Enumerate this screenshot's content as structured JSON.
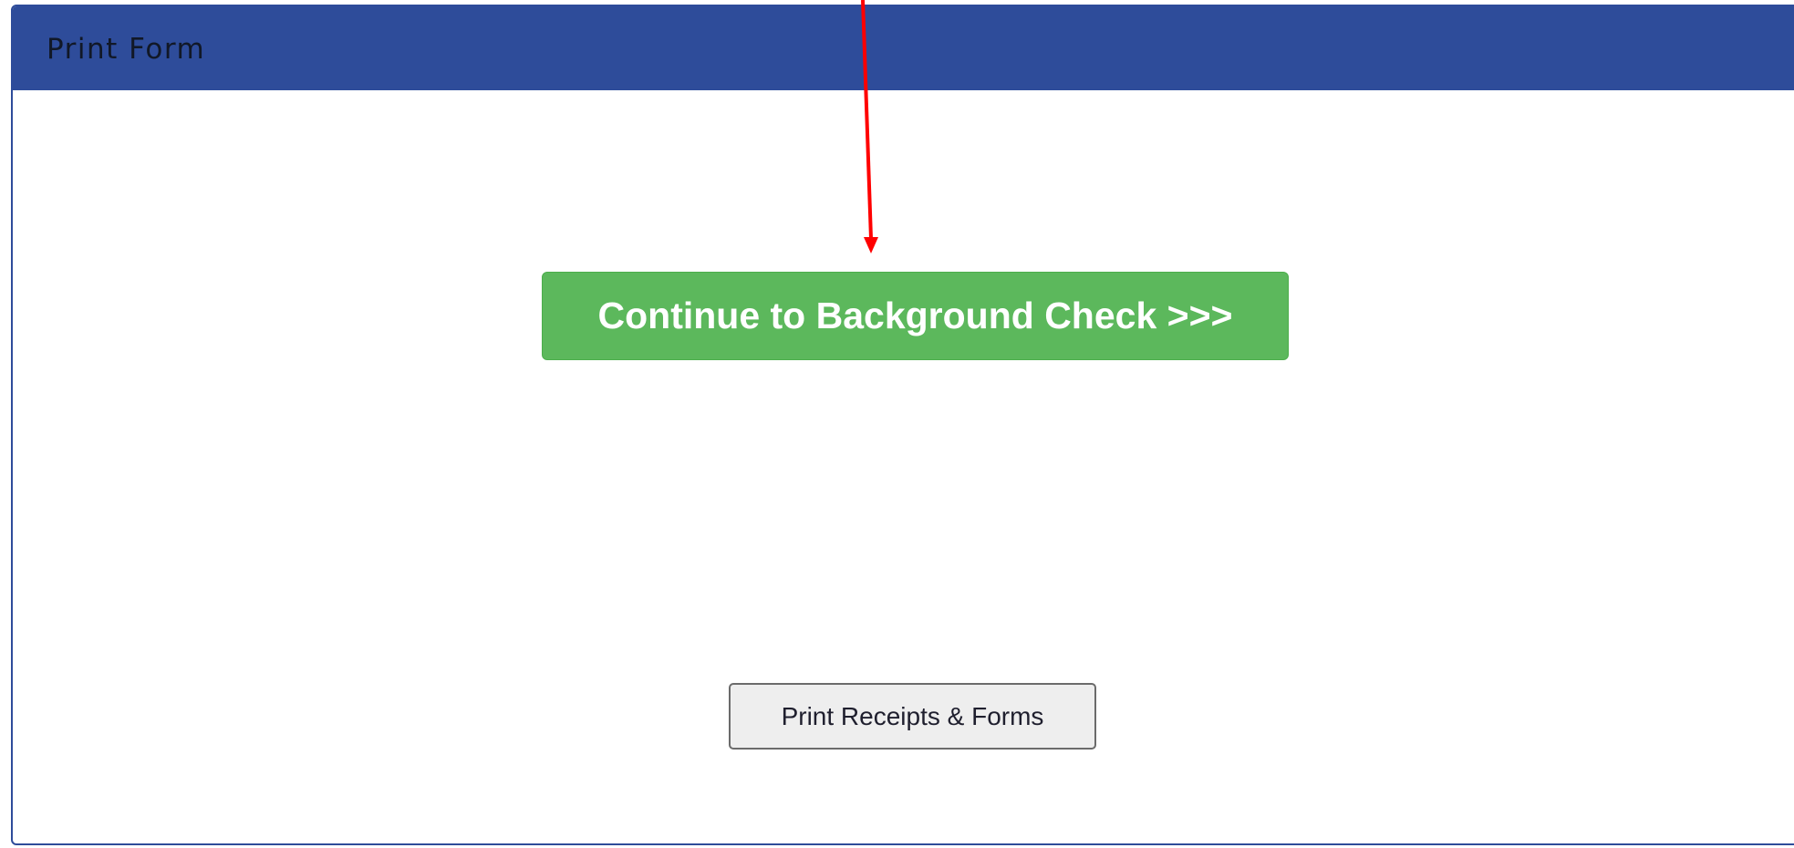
{
  "panel": {
    "title": "Print Form"
  },
  "buttons": {
    "continue_label": "Continue to Background Check >>>",
    "print_label": "Print Receipts & Forms"
  },
  "colors": {
    "header": "#2e4c9a",
    "continue_button": "#5cb85c",
    "print_button": "#eeeeee",
    "annotation_arrow": "#ff0000"
  },
  "icons": {
    "annotation": "red-arrow-icon"
  }
}
